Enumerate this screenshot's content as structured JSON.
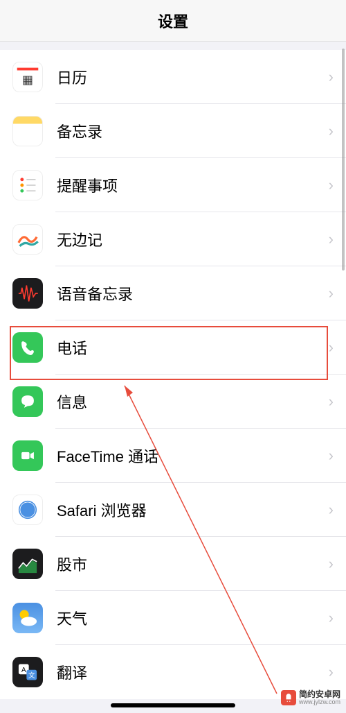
{
  "header": {
    "title": "设置"
  },
  "rows": [
    {
      "id": "calendar",
      "label": "日历"
    },
    {
      "id": "notes",
      "label": "备忘录"
    },
    {
      "id": "reminders",
      "label": "提醒事项"
    },
    {
      "id": "freeform",
      "label": "无边记"
    },
    {
      "id": "voicememos",
      "label": "语音备忘录"
    },
    {
      "id": "phone",
      "label": "电话"
    },
    {
      "id": "messages",
      "label": "信息"
    },
    {
      "id": "facetime",
      "label": "FaceTime 通话"
    },
    {
      "id": "safari",
      "label": "Safari 浏览器"
    },
    {
      "id": "stocks",
      "label": "股市"
    },
    {
      "id": "weather",
      "label": "天气"
    },
    {
      "id": "translate",
      "label": "翻译"
    }
  ],
  "highlight": {
    "target_label": "电话"
  },
  "watermark": {
    "name": "简约安卓网",
    "url": "www.jylzw.com"
  }
}
